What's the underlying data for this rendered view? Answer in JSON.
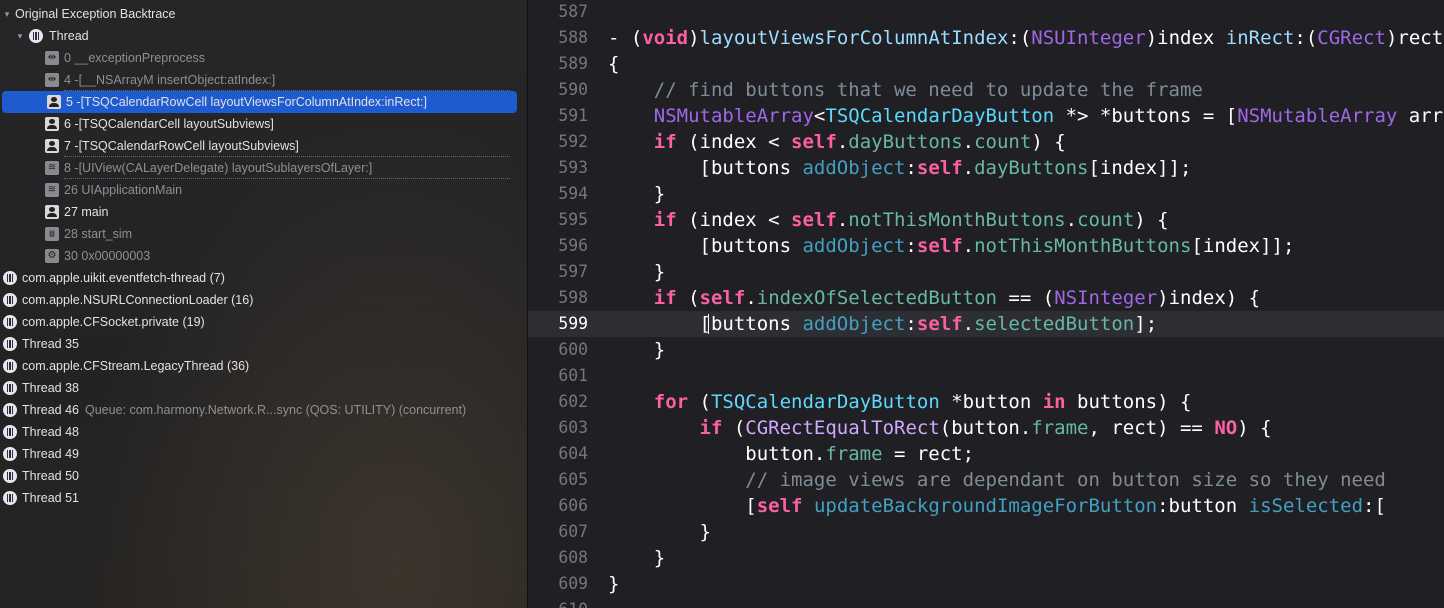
{
  "navigator": {
    "rows": [
      {
        "label": "Original Exception Backtrace",
        "level": 0,
        "disclosure": "▾",
        "icon": "none"
      },
      {
        "label": "Thread",
        "level": 1,
        "disclosure": "▾",
        "icon": "thread"
      },
      {
        "label": "0 __exceptionPreprocess",
        "level": 2,
        "icon": "frame-arrows",
        "dim": true
      },
      {
        "label": "4 -[__NSArrayM insertObject:atIndex:]",
        "level": 2,
        "icon": "frame-arrows",
        "dim": true,
        "dash_after": true
      },
      {
        "label": "5 -[TSQCalendarRowCell layoutViewsForColumnAtIndex:inRect:]",
        "level": 2,
        "icon": "frame-person",
        "selected": true
      },
      {
        "label": "6 -[TSQCalendarCell layoutSubviews]",
        "level": 2,
        "icon": "frame-person"
      },
      {
        "label": "7 -[TSQCalendarRowCell layoutSubviews]",
        "level": 2,
        "icon": "frame-person",
        "dash_after": true
      },
      {
        "label": "8 -[UIView(CALayerDelegate) layoutSublayersOfLayer:]",
        "level": 2,
        "icon": "frame-stack",
        "dim": true,
        "dash_after": true
      },
      {
        "label": "26 UIApplicationMain",
        "level": 2,
        "icon": "frame-stack",
        "dim": true
      },
      {
        "label": "27 main",
        "level": 2,
        "icon": "frame-person"
      },
      {
        "label": "28 start_sim",
        "level": 2,
        "icon": "frame-bank",
        "dim": true
      },
      {
        "label": "30 0x00000003",
        "level": 2,
        "icon": "frame-gear",
        "dim": true
      },
      {
        "label": "com.apple.uikit.eventfetch-thread (7)",
        "level": 0,
        "icon": "thread"
      },
      {
        "label": "com.apple.NSURLConnectionLoader (16)",
        "level": 0,
        "icon": "thread"
      },
      {
        "label": "com.apple.CFSocket.private (19)",
        "level": 0,
        "icon": "thread"
      },
      {
        "label": "Thread 35",
        "level": 0,
        "icon": "thread"
      },
      {
        "label": "com.apple.CFStream.LegacyThread (36)",
        "level": 0,
        "icon": "thread"
      },
      {
        "label": "Thread 38",
        "level": 0,
        "icon": "thread"
      },
      {
        "label": "Thread 46",
        "level": 0,
        "icon": "thread",
        "queue": "Queue: com.harmony.Network.R...sync (QOS: UTILITY) (concurrent)"
      },
      {
        "label": "Thread 48",
        "level": 0,
        "icon": "thread"
      },
      {
        "label": "Thread 49",
        "level": 0,
        "icon": "thread"
      },
      {
        "label": "Thread 50",
        "level": 0,
        "icon": "thread"
      },
      {
        "label": "Thread 51",
        "level": 0,
        "icon": "thread"
      }
    ]
  },
  "editor": {
    "current_line": "599",
    "lines": [
      {
        "num": "587",
        "tokens": []
      },
      {
        "num": "588",
        "tokens": [
          [
            "- (",
            ""
          ],
          [
            "void",
            "k"
          ],
          [
            ")",
            ""
          ],
          [
            "layoutViewsForColumnAtIndex",
            "t"
          ],
          [
            ":(",
            ""
          ],
          [
            "NSUInteger",
            "p"
          ],
          [
            ")index ",
            ""
          ],
          [
            "inRect",
            "t"
          ],
          [
            ":(",
            ""
          ],
          [
            "CGRect",
            "p"
          ],
          [
            ")rect",
            ""
          ]
        ]
      },
      {
        "num": "589",
        "tokens": [
          [
            "{",
            ""
          ]
        ]
      },
      {
        "num": "590",
        "tokens": [
          [
            "    ",
            ""
          ],
          [
            "// find buttons that we need to update the frame",
            "c"
          ]
        ]
      },
      {
        "num": "591",
        "tokens": [
          [
            "    ",
            ""
          ],
          [
            "NSMutableArray",
            "p"
          ],
          [
            "<",
            ""
          ],
          [
            "TSQCalendarDayButton",
            "ty"
          ],
          [
            " *> *buttons = [",
            ""
          ],
          [
            "NSMutableArray",
            "p"
          ],
          [
            " array];",
            ""
          ]
        ]
      },
      {
        "num": "592",
        "tokens": [
          [
            "    ",
            ""
          ],
          [
            "if",
            "k"
          ],
          [
            " (index < ",
            ""
          ],
          [
            "self",
            "k"
          ],
          [
            ".",
            ""
          ],
          [
            "dayButtons",
            "pr"
          ],
          [
            ".",
            ""
          ],
          [
            "count",
            "pr"
          ],
          [
            ") {",
            ""
          ]
        ]
      },
      {
        "num": "593",
        "tokens": [
          [
            "        [buttons ",
            ""
          ],
          [
            "addObject",
            "m"
          ],
          [
            ":",
            ""
          ],
          [
            "self",
            "k"
          ],
          [
            ".",
            ""
          ],
          [
            "dayButtons",
            "pr"
          ],
          [
            "[index]];",
            ""
          ]
        ]
      },
      {
        "num": "594",
        "tokens": [
          [
            "    }",
            ""
          ]
        ]
      },
      {
        "num": "595",
        "tokens": [
          [
            "    ",
            ""
          ],
          [
            "if",
            "k"
          ],
          [
            " (index < ",
            ""
          ],
          [
            "self",
            "k"
          ],
          [
            ".",
            ""
          ],
          [
            "notThisMonthButtons",
            "pr"
          ],
          [
            ".",
            ""
          ],
          [
            "count",
            "pr"
          ],
          [
            ") {",
            ""
          ]
        ]
      },
      {
        "num": "596",
        "tokens": [
          [
            "        [buttons ",
            ""
          ],
          [
            "addObject",
            "m"
          ],
          [
            ":",
            ""
          ],
          [
            "self",
            "k"
          ],
          [
            ".",
            ""
          ],
          [
            "notThisMonthButtons",
            "pr"
          ],
          [
            "[index]];",
            ""
          ]
        ]
      },
      {
        "num": "597",
        "tokens": [
          [
            "    }",
            ""
          ]
        ]
      },
      {
        "num": "598",
        "tokens": [
          [
            "    ",
            ""
          ],
          [
            "if",
            "k"
          ],
          [
            " (",
            ""
          ],
          [
            "self",
            "k"
          ],
          [
            ".",
            ""
          ],
          [
            "indexOfSelectedButton",
            "pr"
          ],
          [
            " == (",
            ""
          ],
          [
            "NSInteger",
            "p"
          ],
          [
            ")index) {",
            ""
          ]
        ]
      },
      {
        "num": "599",
        "tokens": [
          [
            "        [buttons ",
            ""
          ],
          [
            "addObject",
            "m"
          ],
          [
            ":",
            ""
          ],
          [
            "self",
            "k"
          ],
          [
            ".",
            ""
          ],
          [
            "selectedButton",
            "pr"
          ],
          [
            "];",
            ""
          ]
        ]
      },
      {
        "num": "600",
        "tokens": [
          [
            "    }",
            ""
          ]
        ]
      },
      {
        "num": "601",
        "tokens": []
      },
      {
        "num": "602",
        "tokens": [
          [
            "    ",
            ""
          ],
          [
            "for",
            "k"
          ],
          [
            " (",
            ""
          ],
          [
            "TSQCalendarDayButton",
            "ty"
          ],
          [
            " *button ",
            ""
          ],
          [
            "in",
            "k"
          ],
          [
            " buttons) {",
            ""
          ]
        ]
      },
      {
        "num": "603",
        "tokens": [
          [
            "        ",
            ""
          ],
          [
            "if",
            "k"
          ],
          [
            " (",
            ""
          ],
          [
            "CGRectEqualToRect",
            "cls"
          ],
          [
            "(button.",
            ""
          ],
          [
            "frame",
            "pr"
          ],
          [
            ", rect) == ",
            ""
          ],
          [
            "NO",
            "k"
          ],
          [
            ") {",
            ""
          ]
        ]
      },
      {
        "num": "604",
        "tokens": [
          [
            "            button.",
            ""
          ],
          [
            "frame",
            "pr"
          ],
          [
            " = rect;",
            ""
          ]
        ]
      },
      {
        "num": "605",
        "tokens": [
          [
            "            ",
            ""
          ],
          [
            "// image views are dependant on button size so they need",
            "c"
          ]
        ]
      },
      {
        "num": "606",
        "tokens": [
          [
            "            [",
            ""
          ],
          [
            "self",
            "k"
          ],
          [
            " ",
            ""
          ],
          [
            "updateBackgroundImageForButton",
            "m"
          ],
          [
            ":button ",
            ""
          ],
          [
            "isSelected",
            "m"
          ],
          [
            ":[",
            ""
          ]
        ]
      },
      {
        "num": "607",
        "tokens": [
          [
            "        }",
            ""
          ]
        ]
      },
      {
        "num": "608",
        "tokens": [
          [
            "    }",
            ""
          ]
        ]
      },
      {
        "num": "609",
        "tokens": [
          [
            "}",
            ""
          ]
        ]
      },
      {
        "num": "610",
        "tokens": []
      }
    ]
  }
}
